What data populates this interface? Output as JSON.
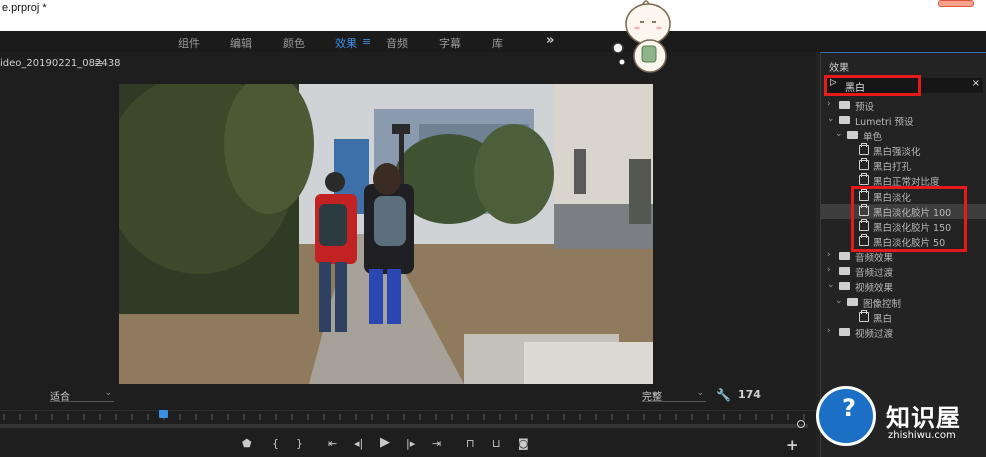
{
  "window": {
    "title": "e.prproj *"
  },
  "workspaces": {
    "items": [
      "组件",
      "编辑",
      "颜色",
      "效果",
      "音频",
      "字幕",
      "库"
    ],
    "active": "效果",
    "more_label": "»",
    "menu_glyph": "≡"
  },
  "program_monitor": {
    "sequence_name": "ideo_20190221_082438",
    "menu_glyph": "≡",
    "zoom_select": "适合",
    "quality_select": "完整",
    "frame_count": "174"
  },
  "transport": {
    "buttons": [
      "marker",
      "mark-in",
      "mark-out",
      "go-to-in",
      "step-back",
      "play",
      "step-forward",
      "go-to-out",
      "insert",
      "overwrite",
      "export-frame"
    ],
    "add_label": "+"
  },
  "effects_panel": {
    "title": "效果",
    "search": {
      "value": "黑白",
      "clear_glyph": "×"
    },
    "tree": [
      {
        "level": 0,
        "kind": "folder",
        "label": "预设",
        "expanded": false
      },
      {
        "level": 0,
        "kind": "folder",
        "label": "Lumetri 预设",
        "expanded": true
      },
      {
        "level": 1,
        "kind": "folder",
        "label": "单色",
        "expanded": true
      },
      {
        "level": 2,
        "kind": "effect",
        "label": "黑白强淡化"
      },
      {
        "level": 2,
        "kind": "effect",
        "label": "黑白打孔"
      },
      {
        "level": 2,
        "kind": "effect",
        "label": "黑白正常对比度"
      },
      {
        "level": 2,
        "kind": "effect",
        "label": "黑白淡化"
      },
      {
        "level": 2,
        "kind": "effect",
        "label": "黑白淡化胶片 100",
        "selected": true
      },
      {
        "level": 2,
        "kind": "effect",
        "label": "黑白淡化胶片 150"
      },
      {
        "level": 2,
        "kind": "effect",
        "label": "黑白淡化胶片 50"
      },
      {
        "level": 0,
        "kind": "folder",
        "label": "音频效果",
        "expanded": false
      },
      {
        "level": 0,
        "kind": "folder",
        "label": "音频过渡",
        "expanded": false
      },
      {
        "level": 0,
        "kind": "folder",
        "label": "视频效果",
        "expanded": true
      },
      {
        "level": 1,
        "kind": "folder",
        "label": "图像控制",
        "expanded": true
      },
      {
        "level": 2,
        "kind": "effect",
        "label": "黑白"
      },
      {
        "level": 0,
        "kind": "folder",
        "label": "视频过渡",
        "expanded": false
      }
    ]
  },
  "watermark": {
    "title": "知识屋",
    "subtitle": "zhishiwu.com"
  },
  "colors": {
    "accent": "#3d8ee6",
    "highlight": "#e51a1a",
    "panel_bg": "#232323"
  }
}
